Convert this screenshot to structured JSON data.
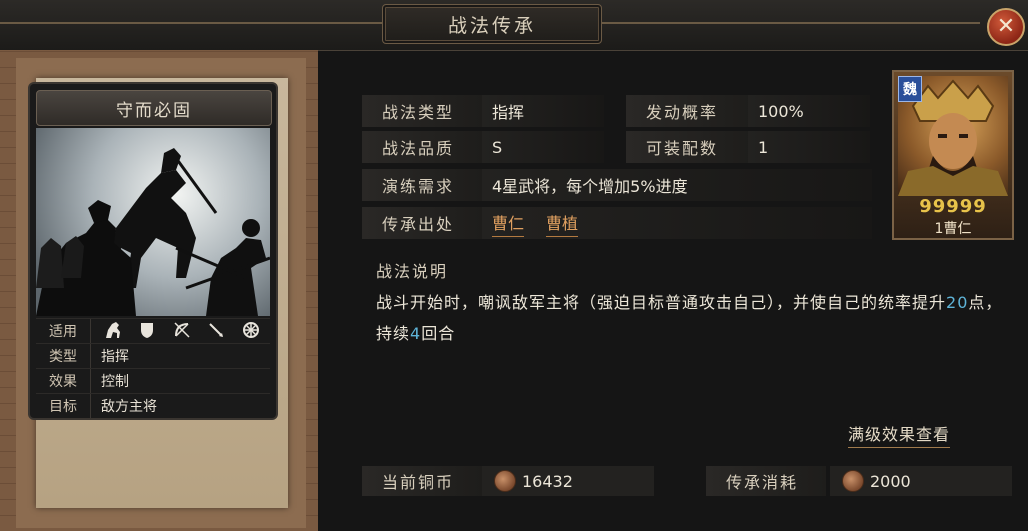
{
  "window": {
    "title": "战法传承",
    "close_icon": "close-icon"
  },
  "card": {
    "title": "守而必固",
    "info": [
      {
        "label": "适用",
        "value": ""
      },
      {
        "label": "类型",
        "value": "指挥"
      },
      {
        "label": "效果",
        "value": "控制"
      },
      {
        "label": "目标",
        "value": "敌方主将"
      }
    ],
    "troop_icons": [
      "cavalry-icon",
      "shield-icon",
      "bow-icon",
      "spear-icon",
      "siege-wheel-icon"
    ]
  },
  "fields": {
    "type_label": "战法类型",
    "type_value": "指挥",
    "trigger_label": "发动概率",
    "trigger_value": "100%",
    "quality_label": "战法品质",
    "quality_value": "S",
    "slots_label": "可装配数",
    "slots_value": "1",
    "req_label": "演练需求",
    "req_value": "4星武将，每个增加5%进度",
    "origin_label": "传承出处",
    "origins": [
      "曹仁",
      "曹植"
    ]
  },
  "description": {
    "heading": "战法说明",
    "part1": "战斗开始时，嘲讽敌军主将（强迫目标普通攻击自己），并使自己的统率提升",
    "value1": "20",
    "part2": "点，持续",
    "value2": "4",
    "part3": "回合"
  },
  "view_maxlevel_link": "满级效果查看",
  "costs": {
    "coins_label": "当前铜币",
    "coins_value": "16432",
    "cost_label": "传承消耗",
    "cost_value": "2000"
  },
  "general": {
    "faction": "魏",
    "stars": "99999",
    "name": "1曹仁"
  },
  "colors": {
    "accent_link": "#e0a060",
    "highlight_number": "#5fb4d8",
    "close_button": "#b0341e"
  }
}
